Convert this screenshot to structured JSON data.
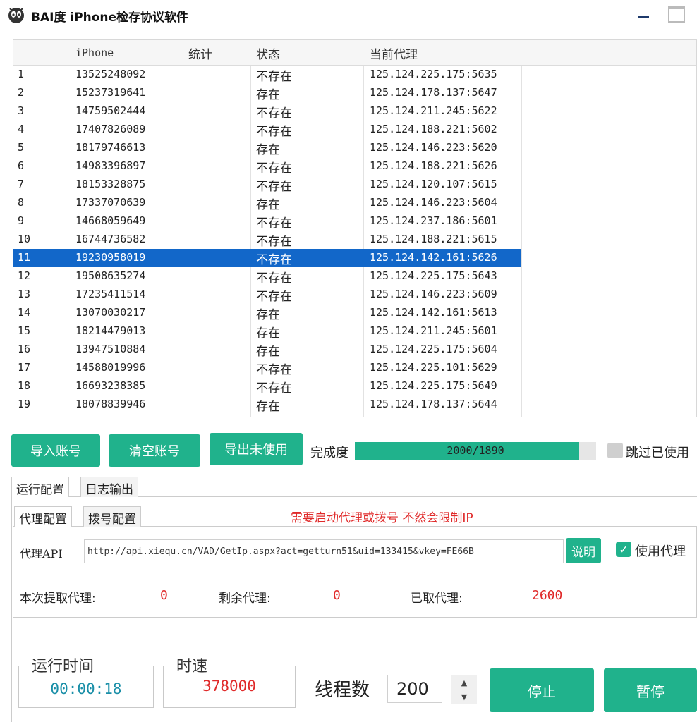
{
  "window": {
    "title": "BAI度 iPhone检存协议软件",
    "icons": {
      "logo": "app-logo-icon",
      "minimize": "minimize-icon",
      "maximize": "maximize-icon"
    }
  },
  "table": {
    "columns": [
      "",
      "iPhone",
      "统计",
      "状态",
      "当前代理"
    ],
    "selected_index": 10,
    "rows": [
      {
        "no": "1",
        "phone": "13525248092",
        "count": "",
        "status": "不存在",
        "proxy": "125.124.225.175:5635"
      },
      {
        "no": "2",
        "phone": "15237319641",
        "count": "",
        "status": "存在",
        "proxy": "125.124.178.137:5647"
      },
      {
        "no": "3",
        "phone": "14759502444",
        "count": "",
        "status": "不存在",
        "proxy": "125.124.211.245:5622"
      },
      {
        "no": "4",
        "phone": "17407826089",
        "count": "",
        "status": "不存在",
        "proxy": "125.124.188.221:5602"
      },
      {
        "no": "5",
        "phone": "18179746613",
        "count": "",
        "status": "存在",
        "proxy": "125.124.146.223:5620"
      },
      {
        "no": "6",
        "phone": "14983396897",
        "count": "",
        "status": "不存在",
        "proxy": "125.124.188.221:5626"
      },
      {
        "no": "7",
        "phone": "18153328875",
        "count": "",
        "status": "不存在",
        "proxy": "125.124.120.107:5615"
      },
      {
        "no": "8",
        "phone": "17337070639",
        "count": "",
        "status": "存在",
        "proxy": "125.124.146.223:5604"
      },
      {
        "no": "9",
        "phone": "14668059649",
        "count": "",
        "status": "不存在",
        "proxy": "125.124.237.186:5601"
      },
      {
        "no": "10",
        "phone": "16744736582",
        "count": "",
        "status": "不存在",
        "proxy": "125.124.188.221:5615"
      },
      {
        "no": "11",
        "phone": "19230958019",
        "count": "",
        "status": "不存在",
        "proxy": "125.124.142.161:5626"
      },
      {
        "no": "12",
        "phone": "19508635274",
        "count": "",
        "status": "不存在",
        "proxy": "125.124.225.175:5643"
      },
      {
        "no": "13",
        "phone": "17235411514",
        "count": "",
        "status": "不存在",
        "proxy": "125.124.146.223:5609"
      },
      {
        "no": "14",
        "phone": "13070030217",
        "count": "",
        "status": "存在",
        "proxy": "125.124.142.161:5613"
      },
      {
        "no": "15",
        "phone": "18214479013",
        "count": "",
        "status": "存在",
        "proxy": "125.124.211.245:5601"
      },
      {
        "no": "16",
        "phone": "13947510884",
        "count": "",
        "status": "存在",
        "proxy": "125.124.225.175:5604"
      },
      {
        "no": "17",
        "phone": "14588019996",
        "count": "",
        "status": "不存在",
        "proxy": "125.124.225.101:5629"
      },
      {
        "no": "18",
        "phone": "16693238385",
        "count": "",
        "status": "不存在",
        "proxy": "125.124.225.175:5649"
      },
      {
        "no": "19",
        "phone": "18078839946",
        "count": "",
        "status": "存在",
        "proxy": "125.124.178.137:5644"
      }
    ]
  },
  "actions": {
    "import": "导入账号",
    "clear": "清空账号",
    "export_unused": "导出未使用"
  },
  "progress": {
    "label": "完成度",
    "text": "2000/1890",
    "fraction": 0.93
  },
  "skip_used": {
    "label": "跳过已使用",
    "checked": false
  },
  "tabs": {
    "main": [
      {
        "label": "运行配置"
      },
      {
        "label": "日志输出"
      }
    ],
    "sub": [
      {
        "label": "代理配置"
      },
      {
        "label": "拨号配置"
      }
    ]
  },
  "warning": "需要启动代理或拨号 不然会限制IP",
  "proxy": {
    "api_label": "代理API",
    "api_url": "http://api.xiequ.cn/VAD/GetIp.aspx?act=getturn51&uid=133415&vkey=FE66B",
    "help_label": "说明",
    "use_proxy_label": "使用代理",
    "use_proxy_checked": true
  },
  "stats": {
    "fetched_label": "本次提取代理:",
    "fetched_value": "0",
    "remaining_label": "剩余代理:",
    "remaining_value": "0",
    "taken_label": "已取代理:",
    "taken_value": "2600"
  },
  "runtime": {
    "label": "运行时间",
    "value": "00:00:18"
  },
  "speed": {
    "label": "时速",
    "value": "378000"
  },
  "threads": {
    "label": "线程数",
    "value": "200"
  },
  "controls": {
    "stop": "停止",
    "pause": "暂停"
  },
  "colors": {
    "accent": "#20b28c",
    "selection": "#1267c9",
    "warning": "#e02a2a",
    "runtime_value": "#1a8fa8",
    "speed_value": "#e02a2a"
  }
}
